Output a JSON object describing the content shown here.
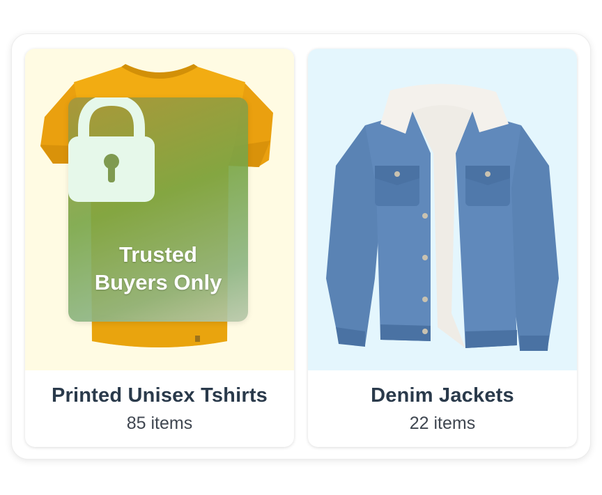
{
  "categories": [
    {
      "title": "Printed Unisex Tshirts",
      "count": "85 items",
      "locked": true,
      "lock_label_line1": "Trusted",
      "lock_label_line2": "Buyers Only",
      "image": "yellow-tshirt",
      "image_bg": "#fffbe3"
    },
    {
      "title": "Denim Jackets",
      "count": "22 items",
      "locked": false,
      "image": "denim-jacket",
      "image_bg": "#e4f6fd"
    }
  ],
  "colors": {
    "title_text": "#2a3a4b",
    "count_text": "#3f4650",
    "tshirt_yellow": "#f2ac12",
    "denim_blue": "#5b86b8",
    "lock_icon": "#e6f8ea"
  }
}
